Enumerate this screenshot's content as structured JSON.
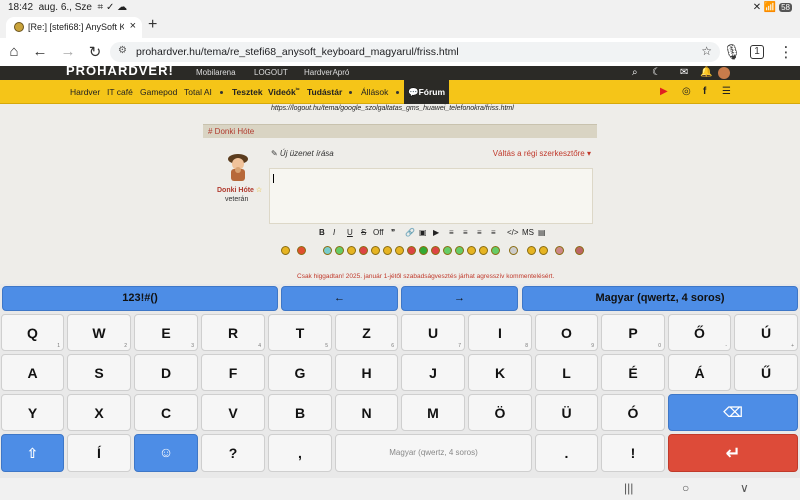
{
  "status": {
    "time": "18:42",
    "date": "aug. 6., Sze",
    "icons_left": "⌗ ✓ ☁",
    "battery": "58",
    "icons_right": "✕ 📶"
  },
  "tab": {
    "title": "[Re:] [stefi68:] AnySoft Keyb",
    "close": "×"
  },
  "newtab": "+",
  "address": {
    "url": "prohardver.hu/tema/re_stefi68_anysoft_keyboard_magyarul/friss.html",
    "tab_count": "1"
  },
  "site": {
    "logo": "PROHARDVER!",
    "top_links": [
      "Mobilarena",
      "LOGOUT",
      "HardverApró"
    ],
    "menu": [
      "Hardver",
      "IT café",
      "Gamepod",
      "Total AI",
      "Tesztek",
      "Videók",
      "Tudástár",
      "Állások"
    ],
    "videos_sup": "ᵇᵉ",
    "forum": "Fórum",
    "social": [
      "▶",
      "◎",
      "f",
      "☰"
    ]
  },
  "post": {
    "prev_link": "https://logout.hu/tema/google_szolgaltatas_gms_huawei_telefonokra/friss.html",
    "header": "# Donki Hóte",
    "username": "Donki Hóte",
    "rank": "veterán",
    "write_label": "✎ Új üzenet írása",
    "switch_label": "Váltás a régi szerkesztőre ▾",
    "toolbar": [
      "B",
      "I",
      "U",
      "S",
      "Off",
      "❞",
      "🔗",
      "▣",
      "▶",
      "≡",
      "≡",
      "≡",
      "≡",
      "</>",
      "MS",
      "▤"
    ],
    "warning": "Csak higgadtan! 2025. január 1-jétől szabadságvesztés járhat agresszív kommentelésért."
  },
  "keyboard": {
    "top_row": [
      "123!#()",
      "←",
      "→",
      "Magyar (qwertz, 4 soros)"
    ],
    "row1": [
      [
        "Q",
        "1"
      ],
      [
        "W",
        "2"
      ],
      [
        "E",
        "3"
      ],
      [
        "R",
        "4"
      ],
      [
        "T",
        "5"
      ],
      [
        "Z",
        "6"
      ],
      [
        "U",
        "7"
      ],
      [
        "I",
        "8"
      ],
      [
        "O",
        "9"
      ],
      [
        "P",
        "0"
      ],
      [
        "Ő",
        "-"
      ],
      [
        "Ú",
        "+"
      ]
    ],
    "row2": [
      [
        "A",
        ""
      ],
      [
        "S",
        ""
      ],
      [
        "D",
        ""
      ],
      [
        "F",
        ""
      ],
      [
        "G",
        ""
      ],
      [
        "H",
        ""
      ],
      [
        "J",
        ""
      ],
      [
        "K",
        ""
      ],
      [
        "L",
        ""
      ],
      [
        "É",
        ""
      ],
      [
        "Á",
        ""
      ],
      [
        "Ű",
        ""
      ]
    ],
    "row3": [
      [
        "Y",
        ""
      ],
      [
        "X",
        ""
      ],
      [
        "C",
        ""
      ],
      [
        "V",
        ""
      ],
      [
        "B",
        ""
      ],
      [
        "N",
        ""
      ],
      [
        "M",
        ""
      ],
      [
        "Ö",
        ""
      ],
      [
        "Ü",
        ""
      ],
      [
        "Ó",
        ""
      ]
    ],
    "row4": [
      "⇧",
      "Í",
      "☺",
      "?",
      ",",
      "Magyar (qwertz, 4 soros)",
      ".",
      "!",
      "↵"
    ],
    "backspace": "⌫"
  },
  "sysnav": [
    "|||",
    "○",
    "∨"
  ],
  "colors": {
    "menu": "#f5c518",
    "kbd_blue": "#4d8de6",
    "kbd_red": "#dd4b39"
  }
}
